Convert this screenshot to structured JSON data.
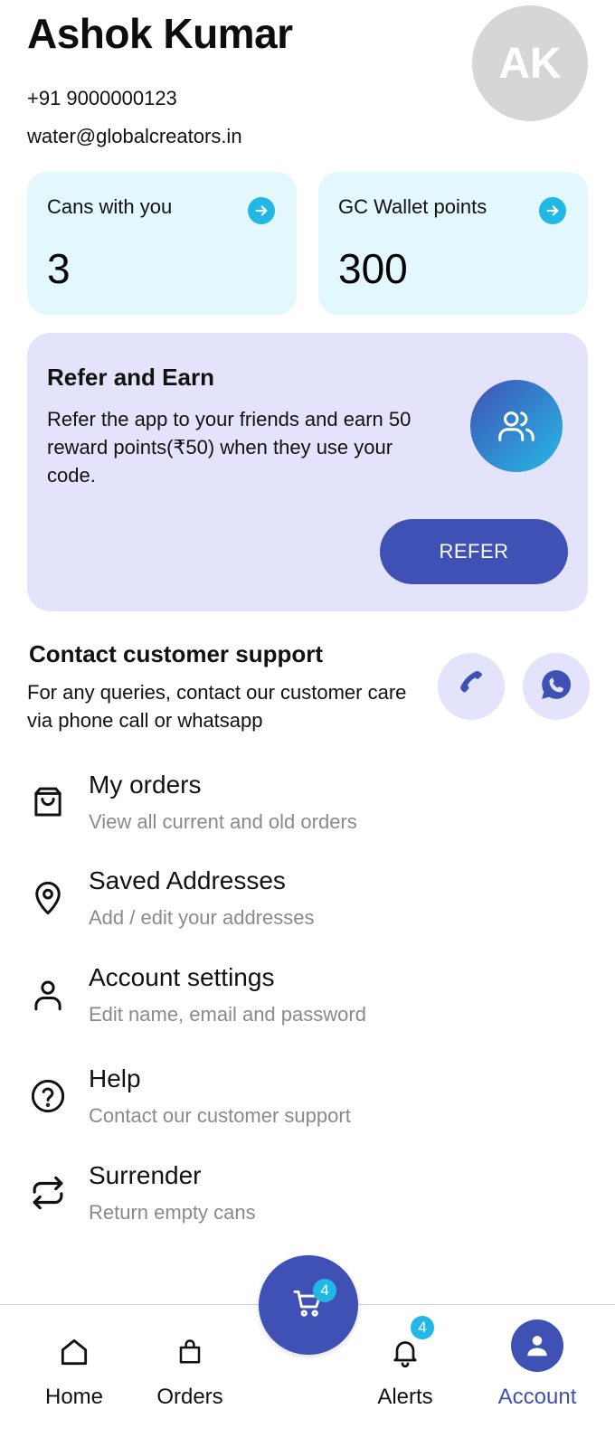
{
  "profile": {
    "name": "Ashok Kumar",
    "phone": "+91 9000000123",
    "email": "water@globalcreators.in",
    "avatar_initials": "AK"
  },
  "stats": {
    "cans": {
      "label": "Cans with you",
      "value": "3",
      "icon": "arrow-right-circle-icon"
    },
    "wallet": {
      "label": "GC Wallet points",
      "value": "300",
      "icon": "arrow-right-circle-icon"
    }
  },
  "refer": {
    "title": "Refer and Earn",
    "description": "Refer the app to your friends and earn 50 reward points(₹50) when they use your code.",
    "button_label": "REFER",
    "icon": "users-icon"
  },
  "support": {
    "title": "Contact customer support",
    "description": "For any queries, contact our customer care via phone call or whatsapp",
    "phone_icon": "phone-icon",
    "whatsapp_icon": "whatsapp-icon"
  },
  "menu": {
    "items": [
      {
        "title": "My orders",
        "subtitle": "View all current and old orders",
        "icon": "shopping-bag-icon"
      },
      {
        "title": "Saved Addresses",
        "subtitle": "Add / edit your addresses",
        "icon": "location-pin-icon"
      },
      {
        "title": "Account settings",
        "subtitle": "Edit name, email and password",
        "icon": "user-icon"
      },
      {
        "title": "Help",
        "subtitle": "Contact our customer support",
        "icon": "help-circle-icon"
      },
      {
        "title": "Surrender",
        "subtitle": "Return empty cans",
        "icon": "repeat-icon"
      }
    ]
  },
  "cart": {
    "badge": "4",
    "icon": "cart-icon"
  },
  "nav": {
    "items": [
      {
        "label": "Home",
        "icon": "home-icon"
      },
      {
        "label": "Orders",
        "icon": "shopping-bag-icon"
      },
      {
        "label": "Alerts",
        "icon": "bell-icon",
        "badge": "4"
      },
      {
        "label": "Account",
        "icon": "account-icon",
        "active": true
      }
    ]
  },
  "colors": {
    "primary": "#3f51b5",
    "accent": "#22b8e6",
    "stat_card_bg": "#e2f8fd",
    "refer_card_bg": "#e3e4fb",
    "muted_text": "#8a8a8a"
  }
}
